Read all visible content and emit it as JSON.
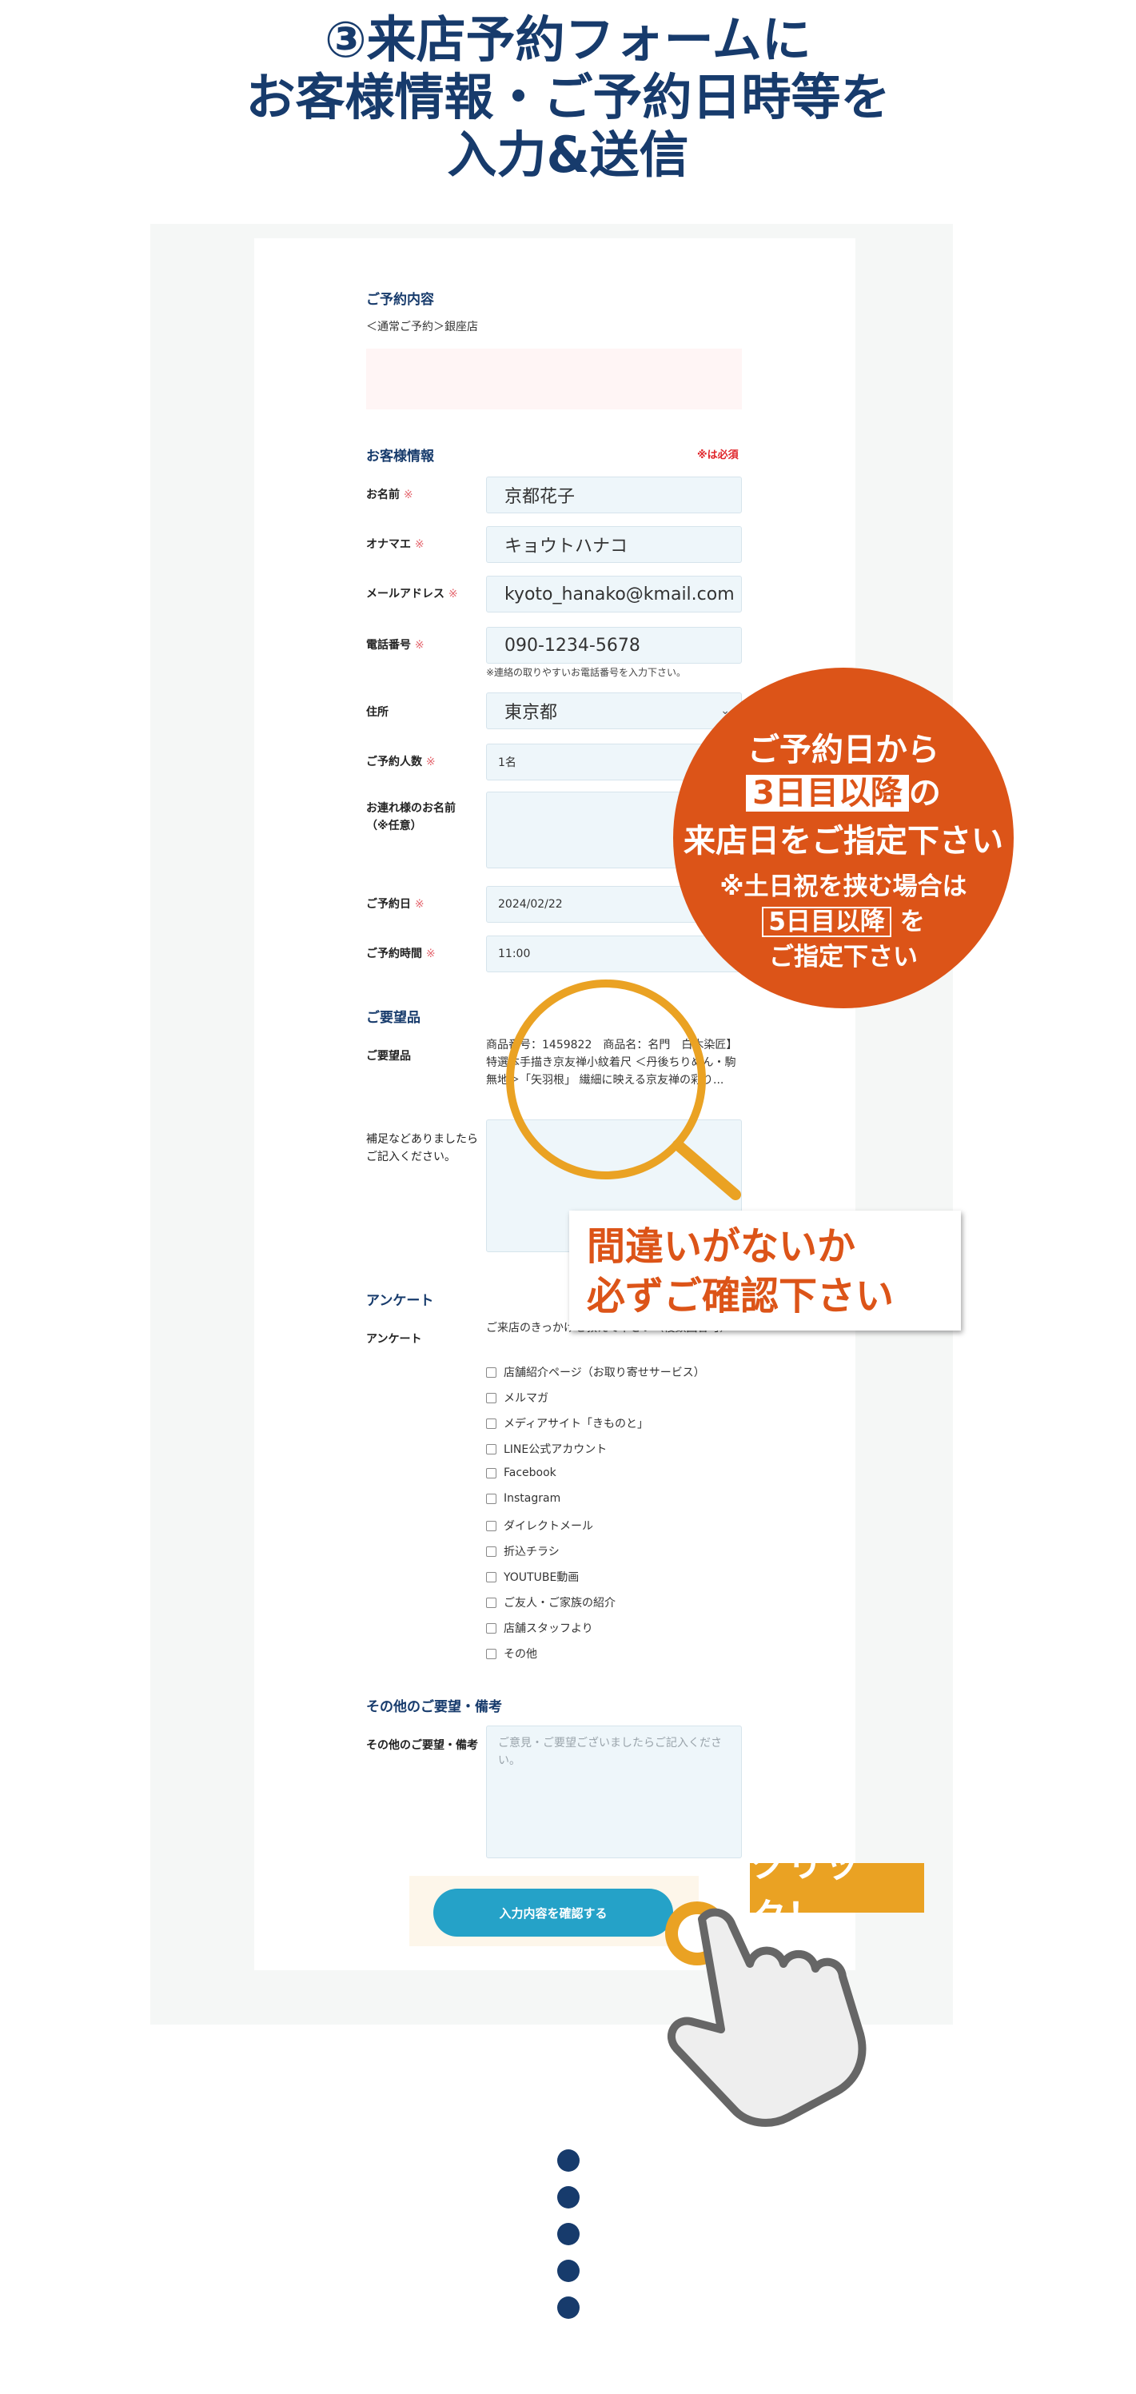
{
  "heading": {
    "line1": "③来店予約フォームに",
    "line2": "お客様情報・ご予約日時等を",
    "line3": "入力&送信"
  },
  "reservation": {
    "title": "ご予約内容",
    "store": "＜通常ご予約＞銀座店"
  },
  "customer": {
    "title": "お客様情報",
    "required_note": "※は必須",
    "required_mark": "※",
    "name_label": "お名前",
    "name_value": "京都花子",
    "kana_label": "オナマエ",
    "kana_value": "キョウトハナコ",
    "email_label": "メールアドレス",
    "email_value": "kyoto_hanako@kmail.com",
    "phone_label": "電話番号",
    "phone_value": "090-1234-5678",
    "phone_help": "※連絡の取りやすいお電話番号を入力下さい。",
    "address_label": "住所",
    "address_value": "東京都",
    "guests_label": "ご予約人数",
    "guests_value": "1名",
    "companion_label_1": "お連れ様のお名前",
    "companion_label_2": "（※任意）",
    "date_label": "ご予約日",
    "date_value": "2024/02/22",
    "time_label": "ご予約時間",
    "time_value": "11:00"
  },
  "request": {
    "title": "ご要望品",
    "item_label": "ご要望品",
    "item_text": "商品番号：1459822　商品名：名門　白木染匠】特選本手描き京友禅小紋着尺 ＜丹後ちりめん・駒無地＞「矢羽根」 繊細に映える京友禅の彩り...",
    "note_label": "補足などありましたらご記入ください。"
  },
  "survey": {
    "title": "アンケート",
    "label": "アンケート",
    "prompt": "ご来店のきっかけを教えて下さい（複数回答可）",
    "options": [
      "店舗紹介ページ（お取り寄せサービス）",
      "メルマガ",
      "メディアサイト「きものと」",
      "LINE公式アカウント",
      "Facebook",
      "Instagram",
      "ダイレクトメール",
      "折込チラシ",
      "YOUTUBE動画",
      "ご友人・ご家族の紹介",
      "店舗スタッフより",
      "その他"
    ]
  },
  "other": {
    "title": "その他のご要望・備考",
    "label": "その他のご要望・備考",
    "placeholder": "ご意見・ご要望ございましたらご記入ください。"
  },
  "submit_label": "入力内容を確認する",
  "callout": {
    "line1": "ご予約日から",
    "highlight": "3日目以降",
    "line2_suffix": "の",
    "line3": "来店日をご指定下さい",
    "line4": "※土日祝を挟む場合は",
    "highlight2": "5日目以降",
    "line5_suffix": "を",
    "line6": "ご指定下さい"
  },
  "warning": {
    "line1": "間違いがないか",
    "line2": "必ずご確認下さい"
  },
  "click_label": "クリック！",
  "colors": {
    "navy": "#173b6c",
    "orange": "#dc5418",
    "button": "#25a2c8",
    "gold": "#eaa223",
    "required": "#e0262b"
  }
}
